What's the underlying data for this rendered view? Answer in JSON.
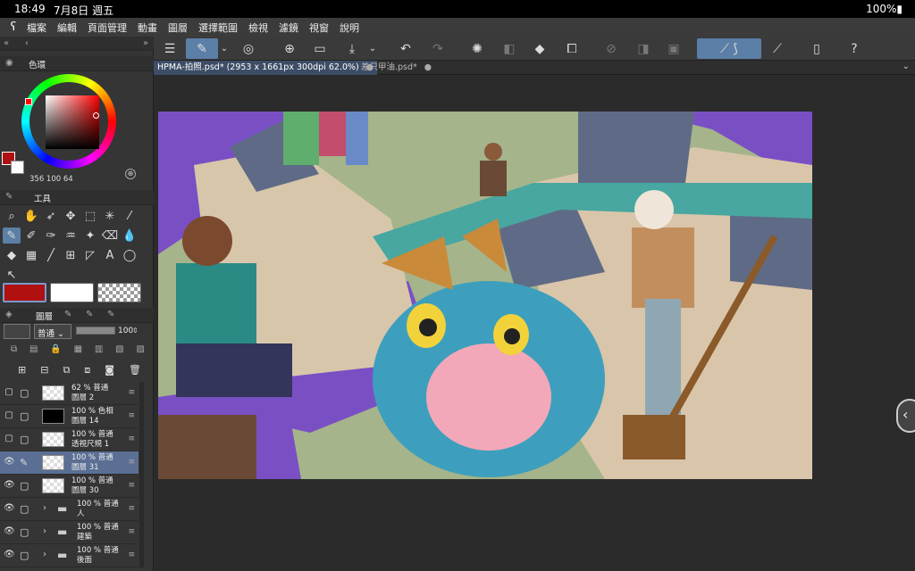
{
  "status": {
    "time": "18:49",
    "date": "7月8日 週五",
    "battery": "100%"
  },
  "menu": [
    "檔案",
    "編輯",
    "頁面管理",
    "動畫",
    "圖層",
    "選擇範圍",
    "檢視",
    "濾鏡",
    "視窗",
    "說明"
  ],
  "tabs": [
    {
      "label": "HPMA-拍照.psd* (2953 x 1661px 300dpi 62.0%)"
    },
    {
      "label": "差只甲油.psd*"
    }
  ],
  "color_panel": {
    "title": "色環",
    "hsv": "356  100  64",
    "main_color": "#b01010",
    "sub_color": "#ffffff"
  },
  "tool_panel": {
    "title": "工具"
  },
  "layer_panel": {
    "title": "圖層",
    "blend_mode": "普通",
    "opacity": "100",
    "layers": [
      {
        "line1": "62 % 普通",
        "line2": "圖層 2",
        "thumb": "checker"
      },
      {
        "line1": "100 % 色相",
        "line2": "圖層 14",
        "thumb": "black"
      },
      {
        "line1": "100 % 普通",
        "line2": "透視尺規 1",
        "thumb": "checker"
      },
      {
        "line1": "100 % 普通",
        "line2": "圖層 31",
        "thumb": "checker"
      },
      {
        "line1": "100 % 普通",
        "line2": "圖層 30",
        "thumb": "checker"
      },
      {
        "line1": "100 % 普通",
        "line2": "人",
        "thumb": "folder"
      },
      {
        "line1": "100 % 普通",
        "line2": "建築",
        "thumb": "folder"
      },
      {
        "line1": "100 % 普通",
        "line2": "後面",
        "thumb": "folder"
      }
    ]
  },
  "accent": "#5b7fa6"
}
